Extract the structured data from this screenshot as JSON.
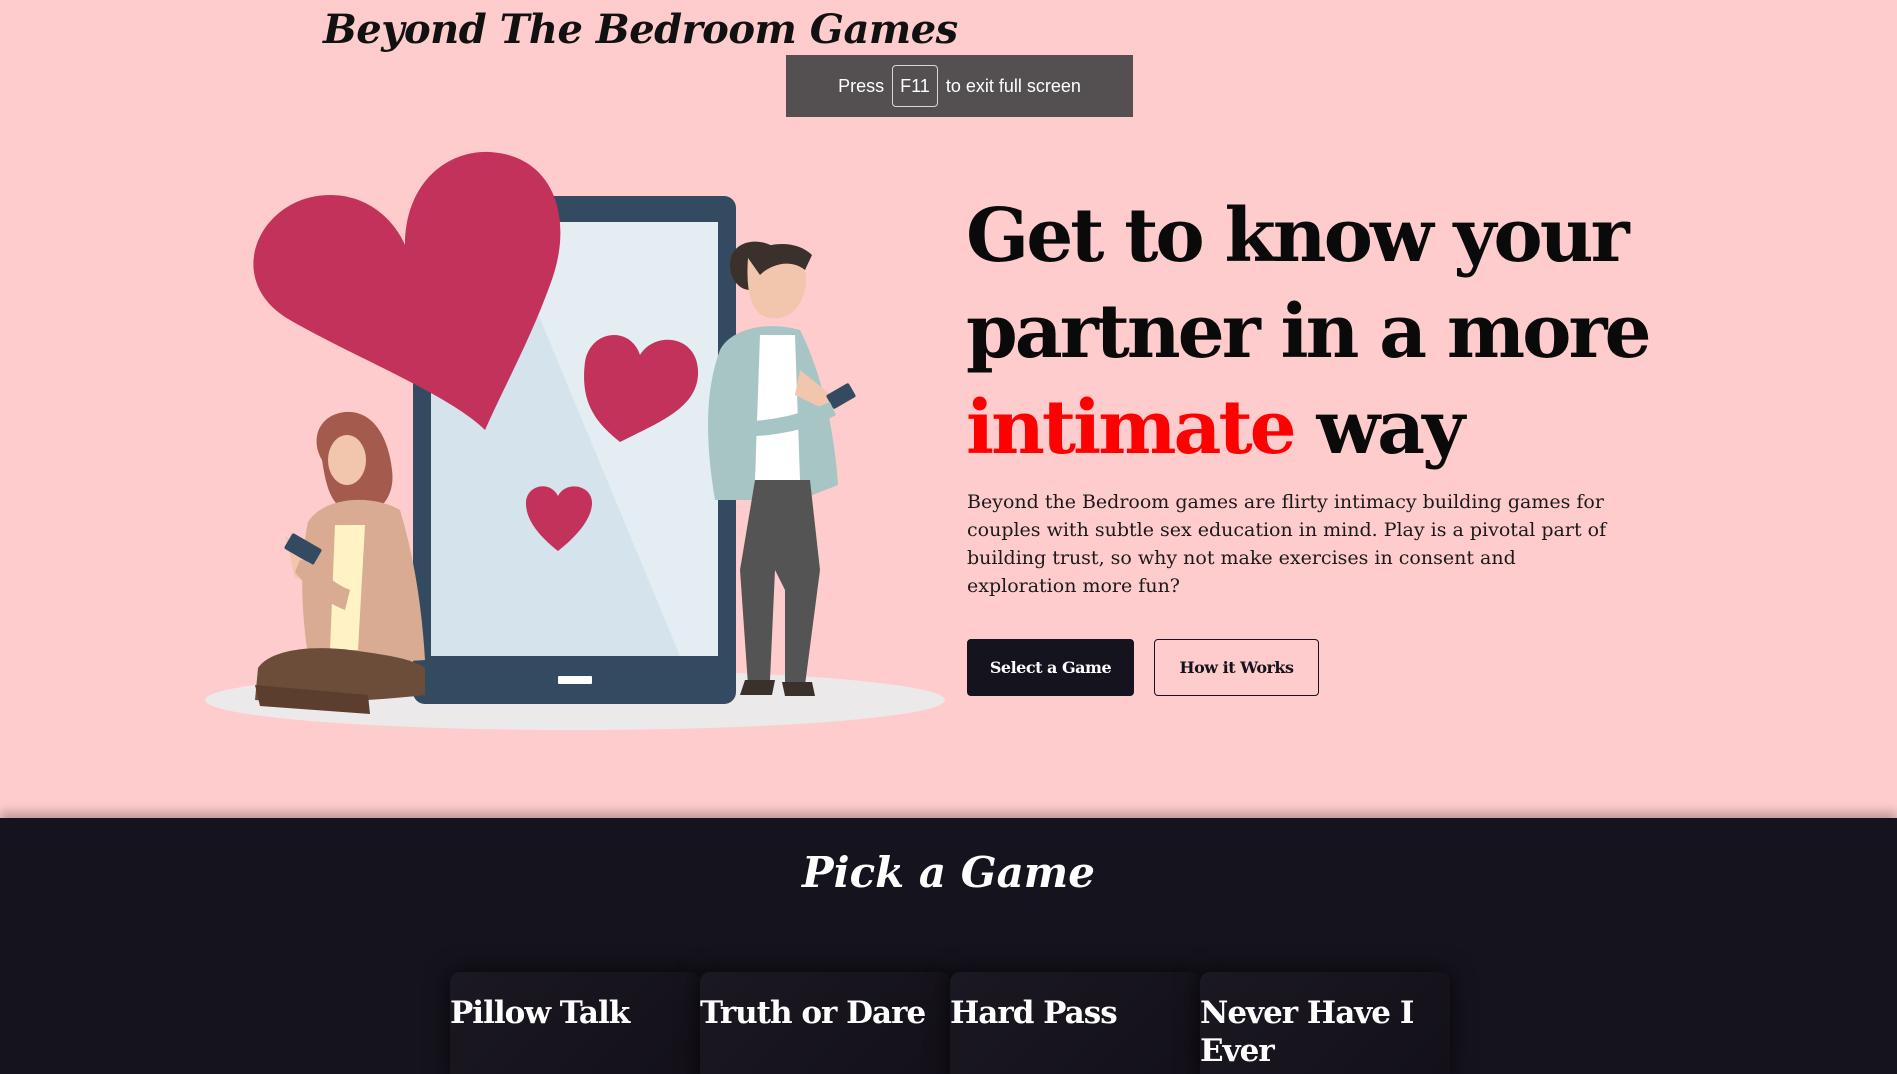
{
  "site": {
    "brand": "Beyond The Bedroom Games"
  },
  "browser": {
    "fullscreen_toast": {
      "before": "Press",
      "key": "F11",
      "after": "to exit full screen"
    }
  },
  "hero": {
    "headline": {
      "line1": "Get to know your",
      "line2": "partner in a more",
      "accent_word": "intimate",
      "end_word": "way"
    },
    "description": "Beyond the Bedroom games are flirty intimacy building games for couples with subtle sex education in mind. Play is a pivotal part of building trust, so why not make exercises in consent and exploration more fun?",
    "primary_button": "Select a Game",
    "secondary_button": "How it Works"
  },
  "games": {
    "title": "Pick a Game",
    "cards": [
      {
        "title": "Pillow Talk"
      },
      {
        "title": "Truth or Dare"
      },
      {
        "title": "Hard Pass"
      },
      {
        "title": "Never Have I Ever"
      }
    ]
  },
  "colors": {
    "hero_background": "#ffcccd",
    "dark_background": "#15131d",
    "accent": "#ff0000",
    "heart": "#c3325a",
    "phone_frame": "#334a60",
    "phone_screen": "#d5e4ec"
  }
}
